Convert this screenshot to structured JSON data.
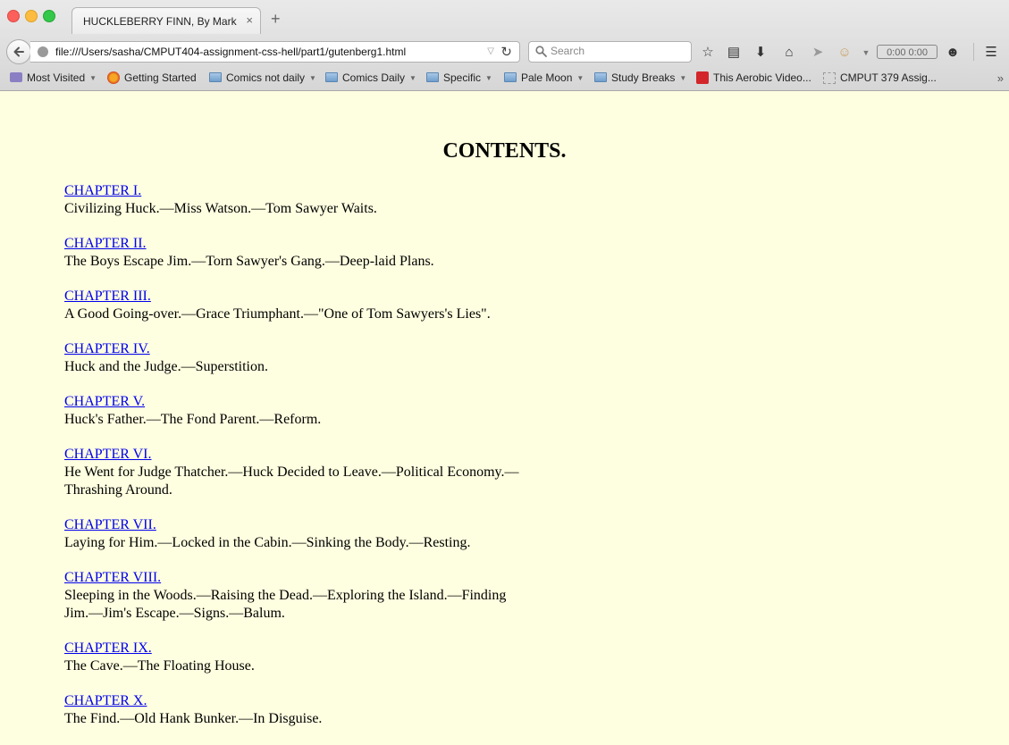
{
  "browser": {
    "tab_title": "HUCKLEBERRY FINN, By Mark ...",
    "tab_close": "×",
    "new_tab": "+",
    "url": "file:///Users/sasha/CMPUT404-assignment-css-hell/part1/gutenberg1.html",
    "search_placeholder": "Search",
    "counter": "0:00  0:00",
    "bookmarks": [
      {
        "label": "Most Visited",
        "icon": "most-visited-icon",
        "dropdown": true
      },
      {
        "label": "Getting Started",
        "icon": "firefox-icon",
        "dropdown": false
      },
      {
        "label": "Comics not daily",
        "icon": "folder-icon",
        "dropdown": true
      },
      {
        "label": "Comics Daily",
        "icon": "folder-icon",
        "dropdown": true
      },
      {
        "label": "Specific",
        "icon": "folder-icon",
        "dropdown": true
      },
      {
        "label": "Pale Moon",
        "icon": "folder-icon",
        "dropdown": true
      },
      {
        "label": "Study Breaks",
        "icon": "folder-icon",
        "dropdown": true
      },
      {
        "label": "This Aerobic Video...",
        "icon": "video-icon",
        "dropdown": false
      },
      {
        "label": "CMPUT 379 Assig...",
        "icon": "page-icon",
        "dropdown": false
      }
    ]
  },
  "page": {
    "title": "CONTENTS.",
    "chapters": [
      {
        "link": "CHAPTER I.",
        "summary": "Civilizing Huck.—Miss Watson.—Tom Sawyer Waits."
      },
      {
        "link": "CHAPTER II.",
        "summary": "The Boys Escape Jim.—Torn Sawyer's Gang.—Deep-laid Plans."
      },
      {
        "link": "CHAPTER III.",
        "summary": "A Good Going-over.—Grace Triumphant.—\"One of Tom Sawyers's Lies\"."
      },
      {
        "link": "CHAPTER IV.",
        "summary": "Huck and the Judge.—Superstition."
      },
      {
        "link": "CHAPTER V.",
        "summary": "Huck's Father.—The Fond Parent.—Reform."
      },
      {
        "link": "CHAPTER VI.",
        "summary": "He Went for Judge Thatcher.—Huck Decided to Leave.—Political Economy.—Thrashing Around."
      },
      {
        "link": "CHAPTER VII.",
        "summary": "Laying for Him.—Locked in the Cabin.—Sinking the Body.—Resting."
      },
      {
        "link": "CHAPTER VIII.",
        "summary": "Sleeping in the Woods.—Raising the Dead.—Exploring the Island.—Finding Jim.—Jim's Escape.—Signs.—Balum."
      },
      {
        "link": "CHAPTER IX.",
        "summary": "The Cave.—The Floating House."
      },
      {
        "link": "CHAPTER X.",
        "summary": "The Find.—Old Hank Bunker.—In Disguise."
      }
    ]
  },
  "colors": {
    "page_bg": "#fefee0",
    "link": "#0000ee"
  }
}
